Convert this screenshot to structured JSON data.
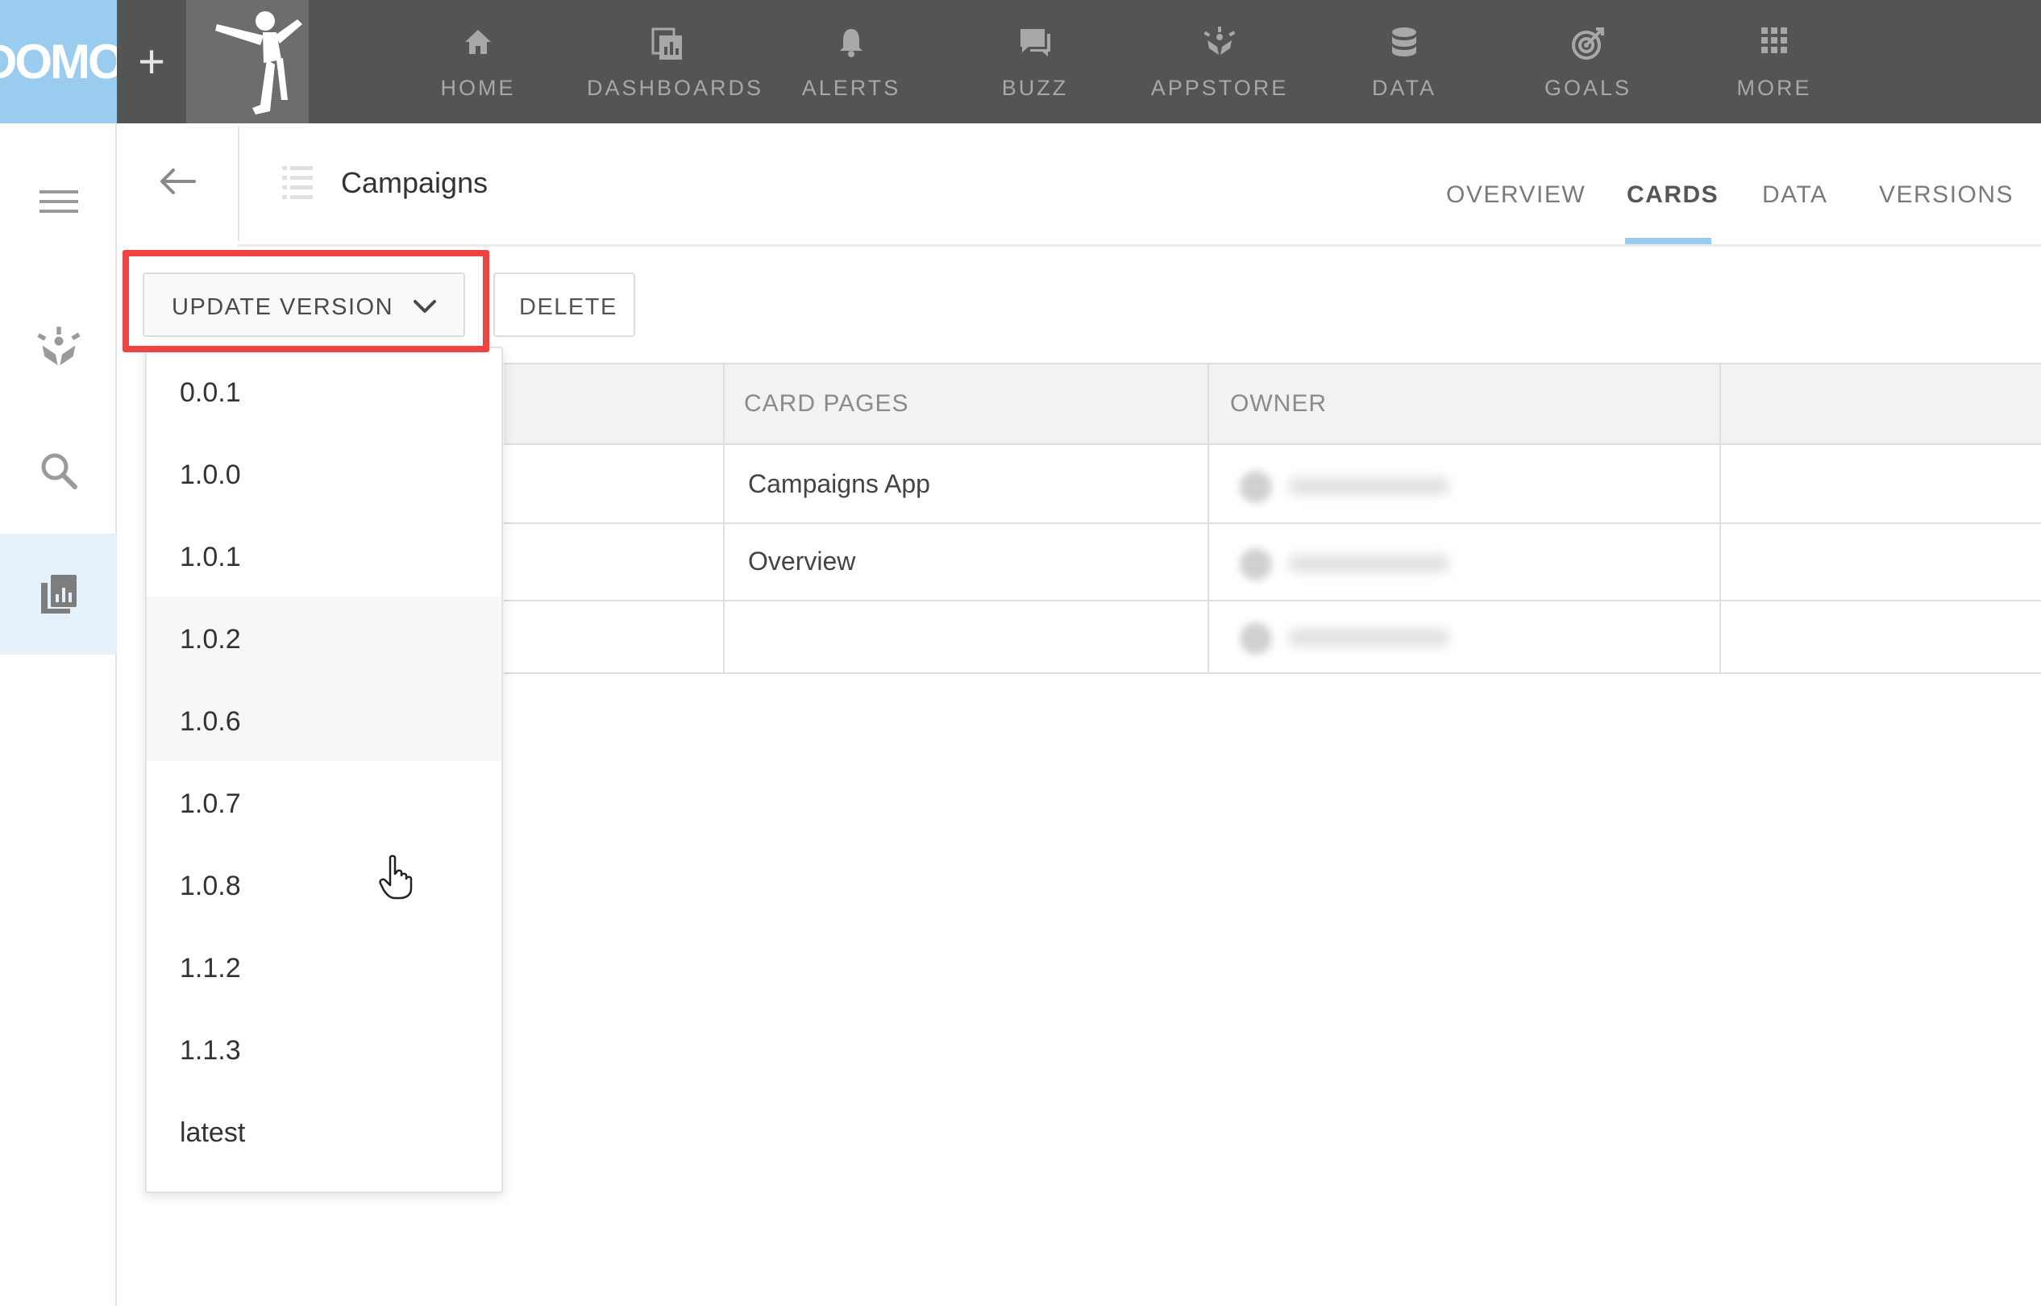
{
  "topbar": {
    "logo_text": "DOMO",
    "add_label": "+",
    "nav": [
      {
        "label": "HOME",
        "icon": "home-icon"
      },
      {
        "label": "DASHBOARDS",
        "icon": "dashboards-icon"
      },
      {
        "label": "ALERTS",
        "icon": "bell-icon"
      },
      {
        "label": "BUZZ",
        "icon": "chat-icon"
      },
      {
        "label": "APPSTORE",
        "icon": "appstore-icon"
      },
      {
        "label": "DATA",
        "icon": "database-icon"
      },
      {
        "label": "GOALS",
        "icon": "target-icon"
      },
      {
        "label": "MORE",
        "icon": "grid-icon"
      }
    ],
    "colors": {
      "bar": "#545454",
      "logo_bg": "#99ccee",
      "label": "#a8a8a8"
    }
  },
  "rail": {
    "items": [
      "menu-icon",
      "appstore-icon",
      "search-icon",
      "cards-icon"
    ],
    "active_index": 3,
    "active_color": "#e4f1fa"
  },
  "header": {
    "title": "Campaigns",
    "tabs": [
      {
        "label": "OVERVIEW",
        "active": false
      },
      {
        "label": "CARDS",
        "active": true
      },
      {
        "label": "DATA",
        "active": false
      },
      {
        "label": "VERSIONS",
        "active": false
      }
    ],
    "accent": "#99ccee"
  },
  "toolbar": {
    "update_label": "UPDATE VERSION",
    "delete_label": "DELETE",
    "highlight_color": "#ef4444"
  },
  "table": {
    "columns": [
      "CARD PAGES",
      "OWNER"
    ],
    "rows": [
      {
        "card_pages": "Campaigns App",
        "owner": ""
      },
      {
        "card_pages": "Overview",
        "owner": ""
      },
      {
        "card_pages": "",
        "owner": ""
      }
    ]
  },
  "version_menu": {
    "options": [
      "0.0.1",
      "1.0.0",
      "1.0.1",
      "1.0.2",
      "1.0.6",
      "1.0.7",
      "1.0.8",
      "1.1.2",
      "1.1.3",
      "latest"
    ],
    "hovered": [
      "1.0.2",
      "1.0.6"
    ]
  }
}
